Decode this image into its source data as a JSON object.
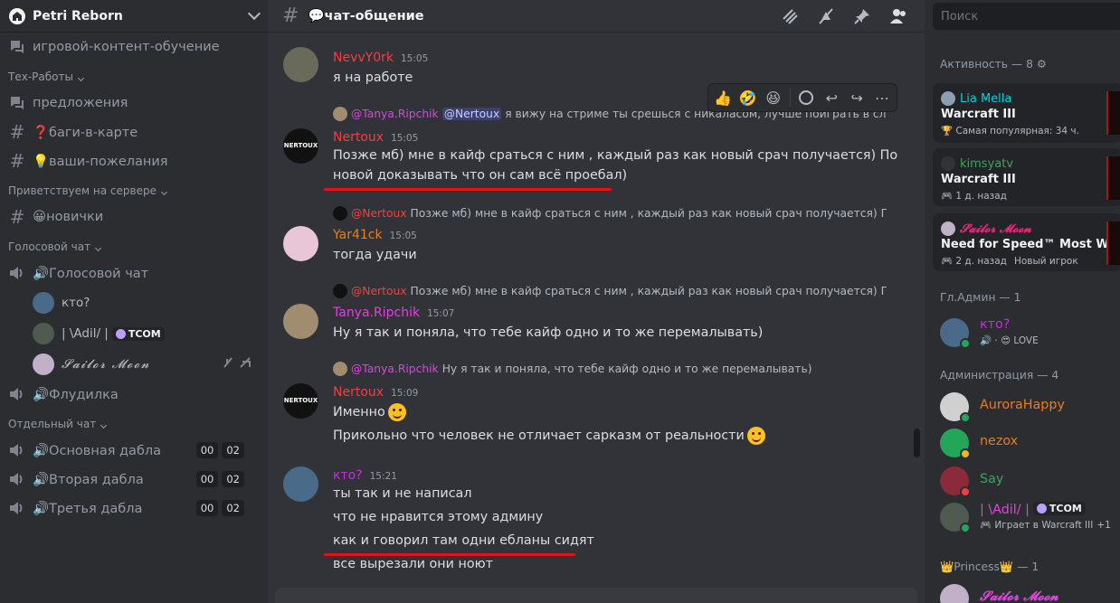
{
  "sidebar": {
    "server_name": "Petri Reborn",
    "items": [
      {
        "type": "channel",
        "label": "игровой-контент-обучение",
        "icon": "forum-icon"
      },
      {
        "type": "category",
        "label": "Тех-Работы"
      },
      {
        "type": "channel",
        "label": "предложения",
        "icon": "forum-icon"
      },
      {
        "type": "channel",
        "label": "❓баги-в-карте",
        "icon": "hash-icon"
      },
      {
        "type": "channel",
        "label": "💡ваши-пожелания",
        "icon": "hash-icon"
      },
      {
        "type": "category",
        "label": "Приветствуем на сервере"
      },
      {
        "type": "channel",
        "label": "😀новички",
        "icon": "hash-icon"
      },
      {
        "type": "category",
        "label": "Голосовой чат"
      },
      {
        "type": "voice",
        "label": "🔊Голосовой чат",
        "icon": "speaker-icon"
      },
      {
        "type": "voice",
        "label": "🔊Флудилка",
        "icon": "speaker-icon"
      },
      {
        "type": "category",
        "label": "Отдельный чат"
      },
      {
        "type": "voice",
        "label": "🔊Основная дабла",
        "icon": "speaker-icon",
        "badge1": "00",
        "badge2": "02"
      },
      {
        "type": "voice",
        "label": "🔊Вторая дабла",
        "icon": "speaker-icon",
        "badge1": "00",
        "badge2": "02"
      },
      {
        "type": "voice",
        "label": "🔊Третья дабла",
        "icon": "speaker-icon",
        "badge1": "00",
        "badge2": "02"
      }
    ],
    "voice_users": [
      {
        "name": "кто?",
        "tag": ""
      },
      {
        "name": "| \\Adil/ |",
        "tag": "TCOM"
      },
      {
        "name": "𝓢𝓪𝓲𝓵𝓸𝓻 𝓜𝓸𝓸𝓷",
        "tag": ""
      }
    ]
  },
  "chat": {
    "channel_name": "💬чат-общение",
    "header_icons": [
      "threads-icon",
      "mute-icon",
      "pin-icon",
      "members-icon"
    ],
    "messages": [
      {
        "author": "NevvY0rk",
        "time": "15:05",
        "color": "#f23f43",
        "avatar": "#6a6a5a",
        "lines": [
          "я на работе"
        ]
      },
      {
        "reply_author": "@Tanya.Ripchik",
        "reply_mention": "@Nertoux",
        "reply_text": "я вижу на стриме ты срешься с никаласом, лучше поиграть в слов...",
        "author": "Nertoux",
        "time": "15:05",
        "color": "#f23f43",
        "avatar": "#111111",
        "lines": [
          "Позже мб) мне в кайф сраться с ним , каждый раз как новый срач получается) По",
          "новой доказывать что он сам всё проебал)"
        ]
      },
      {
        "reply_author": "@Nertoux",
        "reply_text": "Позже мб) мне в кайф сраться с ним , каждый раз как новый срач получается) По но...",
        "author": "Yar41ck",
        "time": "15:05",
        "color": "#e67e22",
        "avatar": "#e8c6d8",
        "lines": [
          "тогда удачи"
        ]
      },
      {
        "reply_author": "@Nertoux",
        "reply_text": "Позже мб) мне в кайф сраться с ним , каждый раз как новый срач получается) По но...",
        "author": "Tanya.Ripchik",
        "time": "15:07",
        "color": "#e042e0",
        "avatar": "#a08c6e",
        "lines": [
          "Ну я так и поняла, что тебе кайф одно и то же перемалывать)"
        ]
      },
      {
        "reply_author": "@Tanya.Ripchik",
        "reply_text": "Ну я так и поняла, что тебе кайф одно и то же перемалывать)",
        "author": "Nertoux",
        "time": "15:09",
        "color": "#f23f43",
        "avatar": "#111111",
        "lines": [
          "Именно",
          "Прикольно что человек не отличает сарказм от реальности"
        ]
      },
      {
        "author": "кто?",
        "time": "15:21",
        "color": "#c032d6",
        "avatar": "#4a6a8a",
        "lines": [
          "ты так и не написал",
          "что не нравится этому админу",
          "как и говорил там одни ебланы сидят",
          "все вырезали они ноют"
        ]
      }
    ],
    "toolbar_icons": [
      "thumbs-up-icon",
      "rofl-icon",
      "grin-icon",
      "add-reaction-icon",
      "reply-icon",
      "forward-icon",
      "more-icon"
    ]
  },
  "right": {
    "search_placeholder": "Поиск",
    "activity_title": "Активность — 8",
    "activity_cards": [
      {
        "user": "Lia Mella",
        "color": "#00d0e0",
        "game": "Warcraft III",
        "sub": "🏆 Самая популярная: 34 ч.",
        "avatar": "#8ea0b0"
      },
      {
        "user": "kimsyatv",
        "color": "#3ba55c",
        "game": "Warcraft III",
        "sub": "🎮 1 д. назад",
        "avatar": "#333333"
      },
      {
        "user": "𝓢𝓪𝓲𝓵𝓸𝓻 𝓜𝓸𝓸𝓷",
        "color": "#e0287a",
        "game": "Need for Speed™ Most Wa...",
        "sub": "🎮 2 д. назад",
        "sub2": "Новый игрок",
        "avatar": "#c0b0c8"
      }
    ],
    "groups": [
      {
        "title": "Гл.Админ — 1",
        "members": [
          {
            "name": "кто?",
            "color": "#c032d6",
            "sub": "🔊 · 😍 LOVE",
            "status": "#23a55a",
            "avatar": "#4a6a8a"
          }
        ]
      },
      {
        "title": "Администрация — 4",
        "members": [
          {
            "name": "AuroraHappy",
            "color": "#e67e22",
            "sub": "",
            "status": "#23a55a",
            "avatar": "#d0d0d0"
          },
          {
            "name": "nezox",
            "color": "#e67e22",
            "sub": "",
            "status": "#f0b232",
            "avatar": "#23a55a"
          },
          {
            "name": "Say",
            "color": "#3ba55c",
            "sub": "",
            "status": "#f23f43",
            "avatar": "#8a2a3a"
          },
          {
            "name": "| \\Adil/ |",
            "color": "#e042e0",
            "sub": "🎮 Играет в Warcraft III",
            "extra": "+1",
            "tag": "TCOM",
            "status": "#23a55a",
            "avatar": "#505a50"
          }
        ]
      },
      {
        "title": "👑Princess👑 — 1",
        "members": [
          {
            "name": "𝓢𝓪𝓲𝓵𝓸𝓻 𝓜𝓸𝓸𝓷",
            "color": "#e042e0",
            "sub": "",
            "status": "#23a55a",
            "avatar": "#c0b0c8"
          }
        ]
      }
    ]
  }
}
